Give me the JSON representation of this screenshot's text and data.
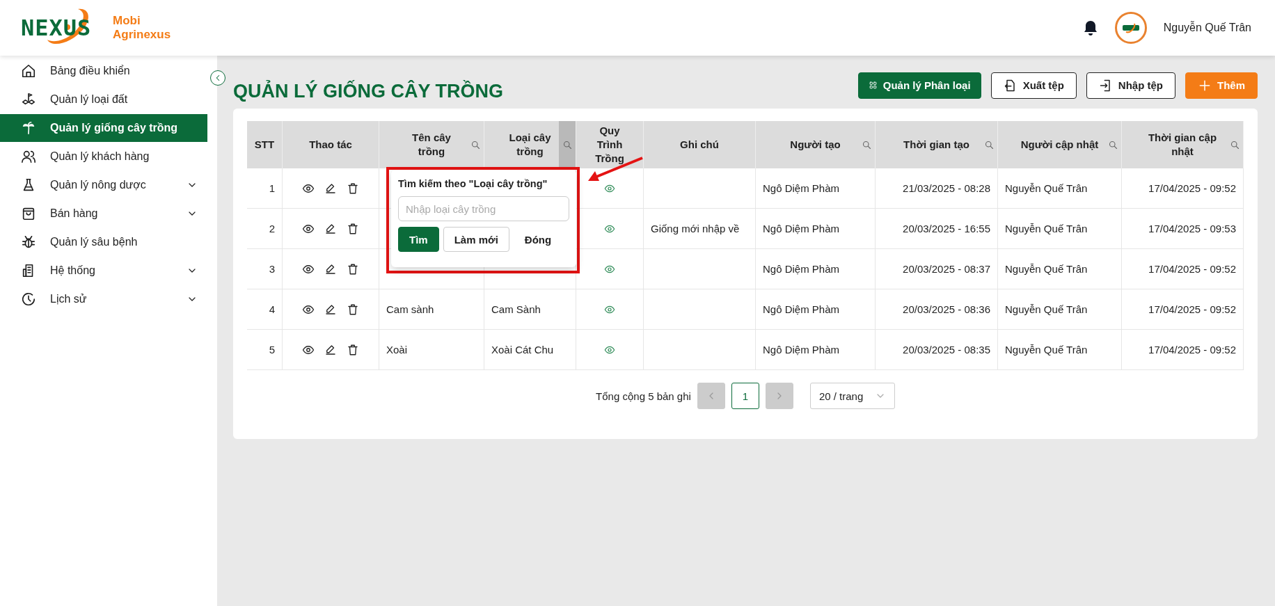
{
  "brand": {
    "logo_text": "NEXUS",
    "lines": [
      "Mobi",
      "Agrinexus"
    ]
  },
  "header": {
    "user_name": "Nguyễn Quế Trân"
  },
  "sidebar": {
    "items": [
      {
        "label": "Bảng điều khiển",
        "selected": false,
        "submenu": false
      },
      {
        "label": "Quản lý loại đất",
        "selected": false,
        "submenu": false
      },
      {
        "label": "Quản lý giống cây trồng",
        "selected": true,
        "submenu": false
      },
      {
        "label": "Quản lý khách hàng",
        "selected": false,
        "submenu": false
      },
      {
        "label": "Quản lý nông dược",
        "selected": false,
        "submenu": true
      },
      {
        "label": "Bán hàng",
        "selected": false,
        "submenu": true
      },
      {
        "label": "Quản lý sâu bệnh",
        "selected": false,
        "submenu": false
      },
      {
        "label": "Hệ thống",
        "selected": false,
        "submenu": true
      },
      {
        "label": "Lịch sử",
        "selected": false,
        "submenu": true
      }
    ]
  },
  "page": {
    "title": "QUẢN LÝ GIỐNG CÂY TRỒNG",
    "actions": [
      {
        "label": "Quản lý Phân loại",
        "kind": "primary"
      },
      {
        "label": "Xuất tệp",
        "kind": "export"
      },
      {
        "label": "Nhập tệp",
        "kind": "import"
      },
      {
        "label": "Thêm",
        "kind": "add"
      }
    ]
  },
  "table": {
    "columns": [
      {
        "label": "STT",
        "filter": false
      },
      {
        "label": "Thao tác",
        "filter": false
      },
      {
        "label": "Tên cây trồng",
        "filter": true,
        "filter_active": false
      },
      {
        "label": "Loại cây trồng",
        "filter": true,
        "filter_active": true
      },
      {
        "label": "Quy Trình Trồng",
        "filter": false
      },
      {
        "label": "Ghi chú",
        "filter": false
      },
      {
        "label": "Người tạo",
        "filter": true,
        "filter_active": false
      },
      {
        "label": "Thời gian tạo",
        "filter": true,
        "filter_active": false
      },
      {
        "label": "Người cập nhật",
        "filter": true,
        "filter_active": false
      },
      {
        "label": "Thời gian cập nhật",
        "filter": true,
        "filter_active": false
      }
    ],
    "rows": [
      {
        "stt": "1",
        "creator": "Ngô Diệm Phàm",
        "created": "21/03/2025 - 08:28",
        "updater": "Nguyễn Quế Trân",
        "updated": "17/04/2025 - 09:52"
      },
      {
        "stt": "2",
        "note": "Giống mới nhập về",
        "creator": "Ngô Diệm Phàm",
        "created": "20/03/2025 - 16:55",
        "updater": "Nguyễn Quế Trân",
        "updated": "17/04/2025 - 09:53"
      },
      {
        "stt": "3",
        "creator": "Ngô Diệm Phàm",
        "created": "20/03/2025 - 08:37",
        "updater": "Nguyễn Quế Trân",
        "updated": "17/04/2025 - 09:52"
      },
      {
        "stt": "4",
        "name": "Cam sành",
        "type": "Cam Sành",
        "creator": "Ngô Diệm Phàm",
        "created": "20/03/2025 - 08:36",
        "updater": "Nguyễn Quế Trân",
        "updated": "17/04/2025 - 09:52"
      },
      {
        "stt": "5",
        "name": "Xoài",
        "type": "Xoài Cát Chu",
        "creator": "Ngô Diệm Phàm",
        "created": "20/03/2025 - 08:35",
        "updater": "Nguyễn Quế Trân",
        "updated": "17/04/2025 - 09:52"
      }
    ]
  },
  "filter_popup": {
    "title": "Tìm kiếm theo \"Loại cây trồng\"",
    "placeholder": "Nhập loại cây trồng",
    "buttons": [
      {
        "label": "Tìm",
        "kind": "primary"
      },
      {
        "label": "Làm mới",
        "kind": "outline"
      },
      {
        "label": "Đóng",
        "kind": "text"
      }
    ]
  },
  "pagination": {
    "total": "Tổng cộng 5 bản ghi",
    "pages": [
      {
        "label": "1",
        "selected": true
      }
    ],
    "page_size": "20 / trang"
  }
}
